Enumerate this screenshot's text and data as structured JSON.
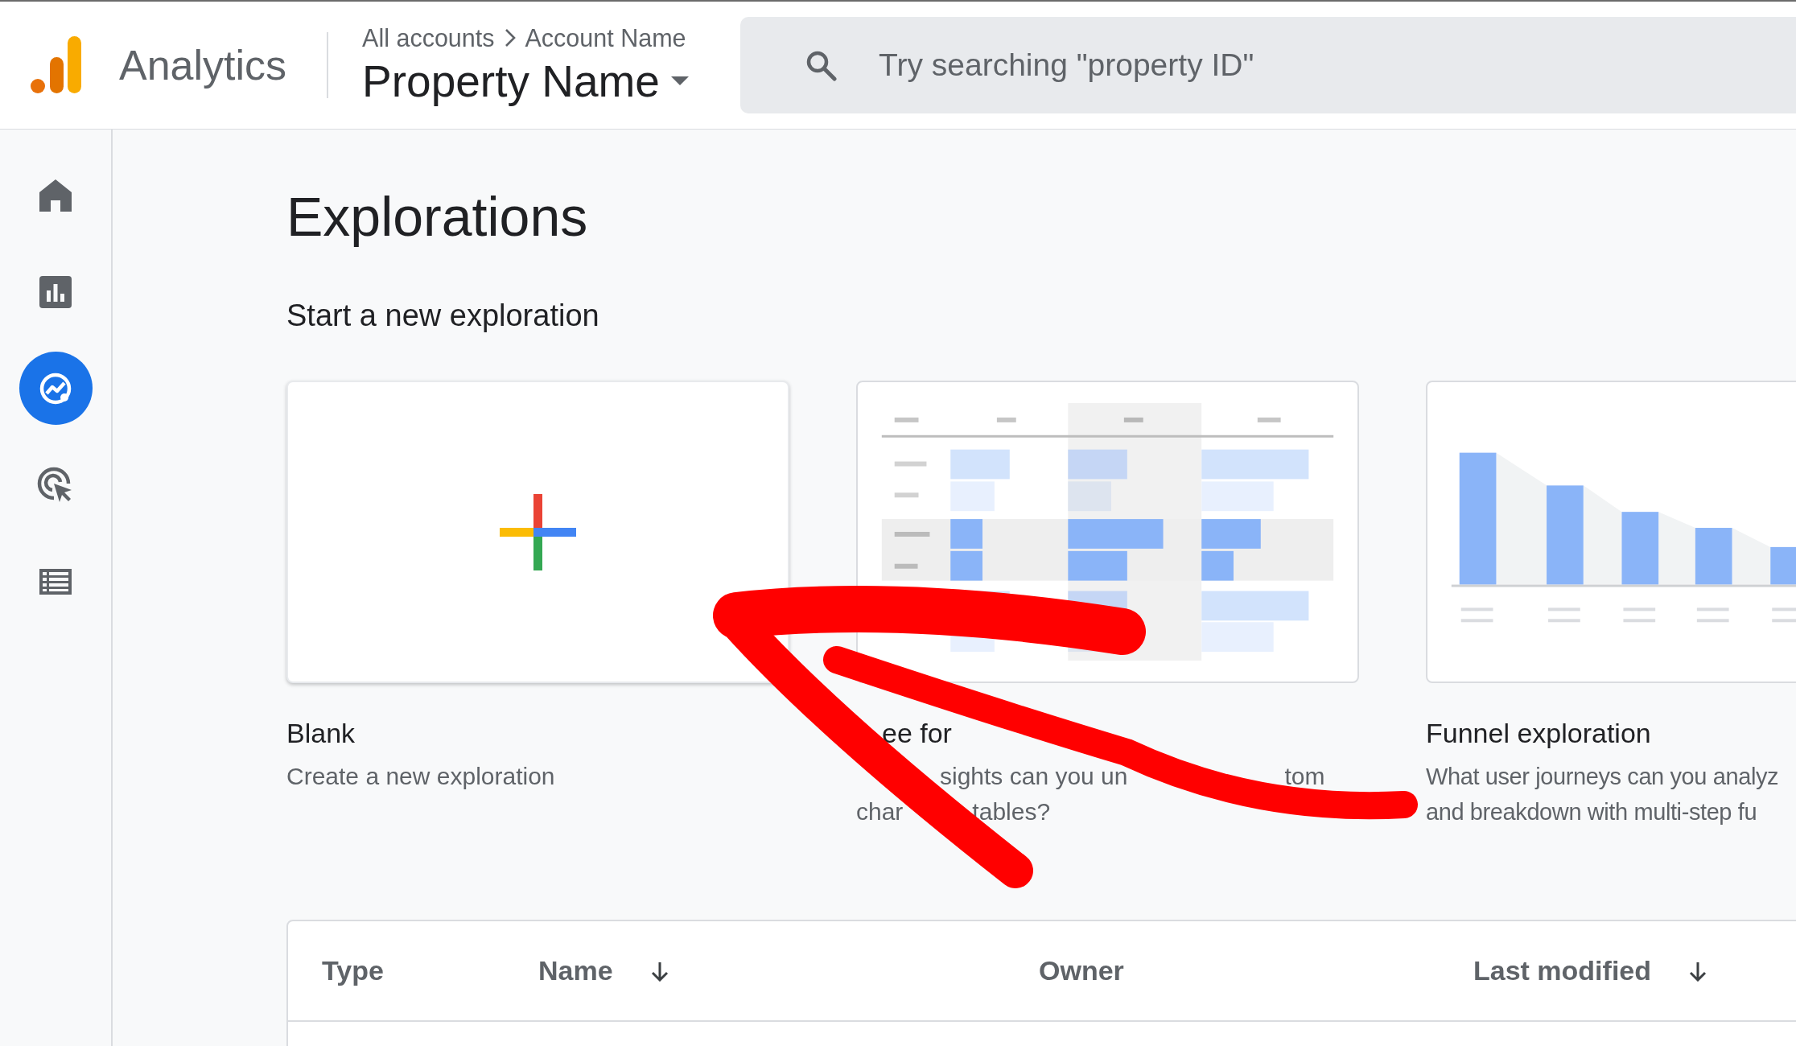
{
  "header": {
    "product": "Analytics",
    "breadcrumb": [
      "All accounts",
      "Account Name"
    ],
    "property": "Property Name",
    "search": {
      "placeholder": "Try searching \"property ID\""
    }
  },
  "nav": [
    {
      "kind": "home",
      "selected": false
    },
    {
      "kind": "reports",
      "selected": false
    },
    {
      "kind": "explore",
      "selected": true
    },
    {
      "kind": "advertising",
      "selected": false
    },
    {
      "kind": "configure",
      "selected": false
    }
  ],
  "page": {
    "title": "Explorations",
    "subtitle": "Start a new exploration"
  },
  "templates": [
    {
      "kind": "blank",
      "title": "Blank",
      "lines": [
        [
          "Create a new exploration"
        ]
      ]
    },
    {
      "kind": "free_form",
      "title": "ee for",
      "lines": [
        [
          "sights can you un",
          "tom"
        ],
        [
          "char",
          "tables?"
        ]
      ]
    },
    {
      "kind": "funnel",
      "title": "Funnel exploration",
      "lines": [
        [
          "What user journeys can you analyz"
        ],
        [
          "and breakdown with multi-step fu"
        ]
      ]
    }
  ],
  "table": {
    "columns": [
      {
        "label": "Type",
        "sorted": false
      },
      {
        "label": "Name",
        "sorted": true
      },
      {
        "label": "Owner",
        "sorted": false
      },
      {
        "label": "Last modified",
        "sorted": true
      }
    ]
  }
}
